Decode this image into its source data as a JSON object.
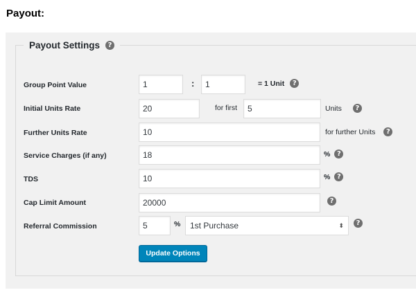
{
  "page": {
    "heading": "Payout:"
  },
  "settings": {
    "legend": "Payout Settings",
    "help_glyph": "?",
    "rows": {
      "group_point": {
        "label": "Group Point Value",
        "value_left": "1",
        "separator": ":",
        "value_right": "1",
        "suffix": "= 1 Unit"
      },
      "initial_units": {
        "label": "Initial Units Rate",
        "value": "20",
        "mid_text": "for first",
        "count": "5",
        "suffix": "Units"
      },
      "further_units": {
        "label": "Further Units Rate",
        "value": "10",
        "suffix": "for further Units"
      },
      "service_charges": {
        "label": "Service Charges (if any)",
        "value": "18",
        "suffix": "%"
      },
      "tds": {
        "label": "TDS",
        "value": "10",
        "suffix": "%"
      },
      "cap_limit": {
        "label": "Cap Limit Amount",
        "value": "20000"
      },
      "referral": {
        "label": "Referral Commission",
        "value": "5",
        "unit": "%",
        "select_value": "1st Purchase",
        "select_arrow": "⬍"
      }
    },
    "submit_label": "Update Options"
  },
  "colors": {
    "button": "#0085ba",
    "panel": "#f1f1f1",
    "help_icon": "#6f6f6f"
  },
  "icons": {
    "help": "question-circle-icon",
    "select": "select-arrows-icon"
  }
}
